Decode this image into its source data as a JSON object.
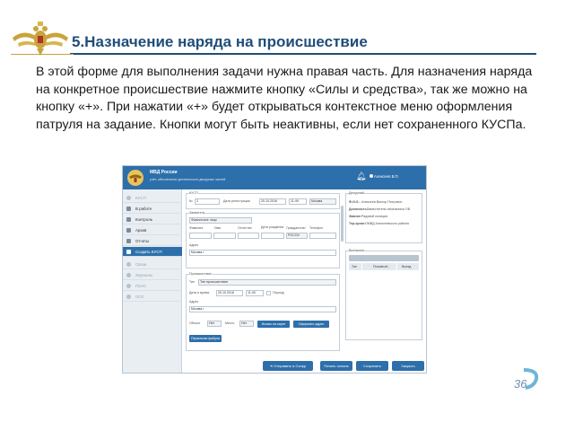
{
  "slide": {
    "title": "5.Назначение наряда на происшествие",
    "body": "В этой форме для выполнения задачи нужна правая часть. Для назначения наряда на конкретное происшествие нажмите кнопку «Силы и средства», так же можно на кнопку «+». При нажатии «+» будет открываться контекстное меню оформления патруля на задание. Кнопки могут быть неактивны, если нет сохраненного КУСПа.",
    "page_number": "36"
  },
  "app": {
    "header": {
      "name": "МВД России",
      "subtitle": "учёт, обеспечение деятельности дежурных частей",
      "user": "Алексеев В.П."
    },
    "sidebar": [
      {
        "label": "КУСП",
        "state": "muted"
      },
      {
        "label": "В работе",
        "state": "normal"
      },
      {
        "label": "Контроль",
        "state": "normal"
      },
      {
        "label": "Архив",
        "state": "normal"
      },
      {
        "label": "Отчеты",
        "state": "normal"
      },
      {
        "label": "Создать КУСП",
        "state": "active"
      },
      {
        "label": "Связи",
        "state": "muted"
      },
      {
        "label": "Журналы",
        "state": "muted"
      },
      {
        "label": "ПОАС",
        "state": "muted"
      },
      {
        "label": "ООС",
        "state": "muted"
      }
    ],
    "form": {
      "kusp_group": "КУСП",
      "number_label": "№",
      "number_value": "2",
      "reg_date_label": "Дата регистрации",
      "reg_date": "20.10.2016",
      "reg_time": "11:49",
      "reg_place": "Москва",
      "applicant_group": "Заявитель",
      "applicant_type": "Физическое лицо",
      "surname_label": "Фамилия",
      "name_label": "Имя",
      "patronymic_label": "Отчество",
      "birth_label": "Дата рождения",
      "citizenship_label": "Гражданство",
      "citizenship_value": "РОССИ",
      "phone_label": "Телефон",
      "address_label": "Адрес",
      "address_value": "Москва г",
      "incident_group": "Происшествие",
      "type_label": "Тип",
      "type_value": "Тип происшествия",
      "datetime_label": "Дата и время",
      "inc_date": "20.10.2016",
      "inc_time": "11:49",
      "period_label": "Период",
      "inc_address_label": "Адрес",
      "inc_address_value": "Москва г",
      "object_label": "Объект",
      "object_value": "Нет",
      "place_label": "Место",
      "place_value": "Нет",
      "map_search_btn": "Искать на карте",
      "form_address_btn": "Оформить адрес",
      "primary_fabula_btn": "Первичная фабула"
    },
    "duty": {
      "group": "Дежурный",
      "fio_label": "Ф.И.О.:",
      "fio_value": "Алексеев Виктор Петрович",
      "position_label": "Должность:",
      "position_value": "Заместитель начальника ОВ",
      "rank_label": "Звание:",
      "rank_value": "Рядовой полиции",
      "organ_label": "Тер.орган:",
      "organ_value": "ОМВД Алексеевского района"
    },
    "dispatch": {
      "group": "Выезжали",
      "columns": [
        "Тип",
        "Позывной...",
        "Выезд"
      ]
    },
    "actions": {
      "send": "Отправить в Сопрр",
      "print": "Печать талона",
      "save": "Сохранить",
      "close": "Закрыть"
    }
  }
}
